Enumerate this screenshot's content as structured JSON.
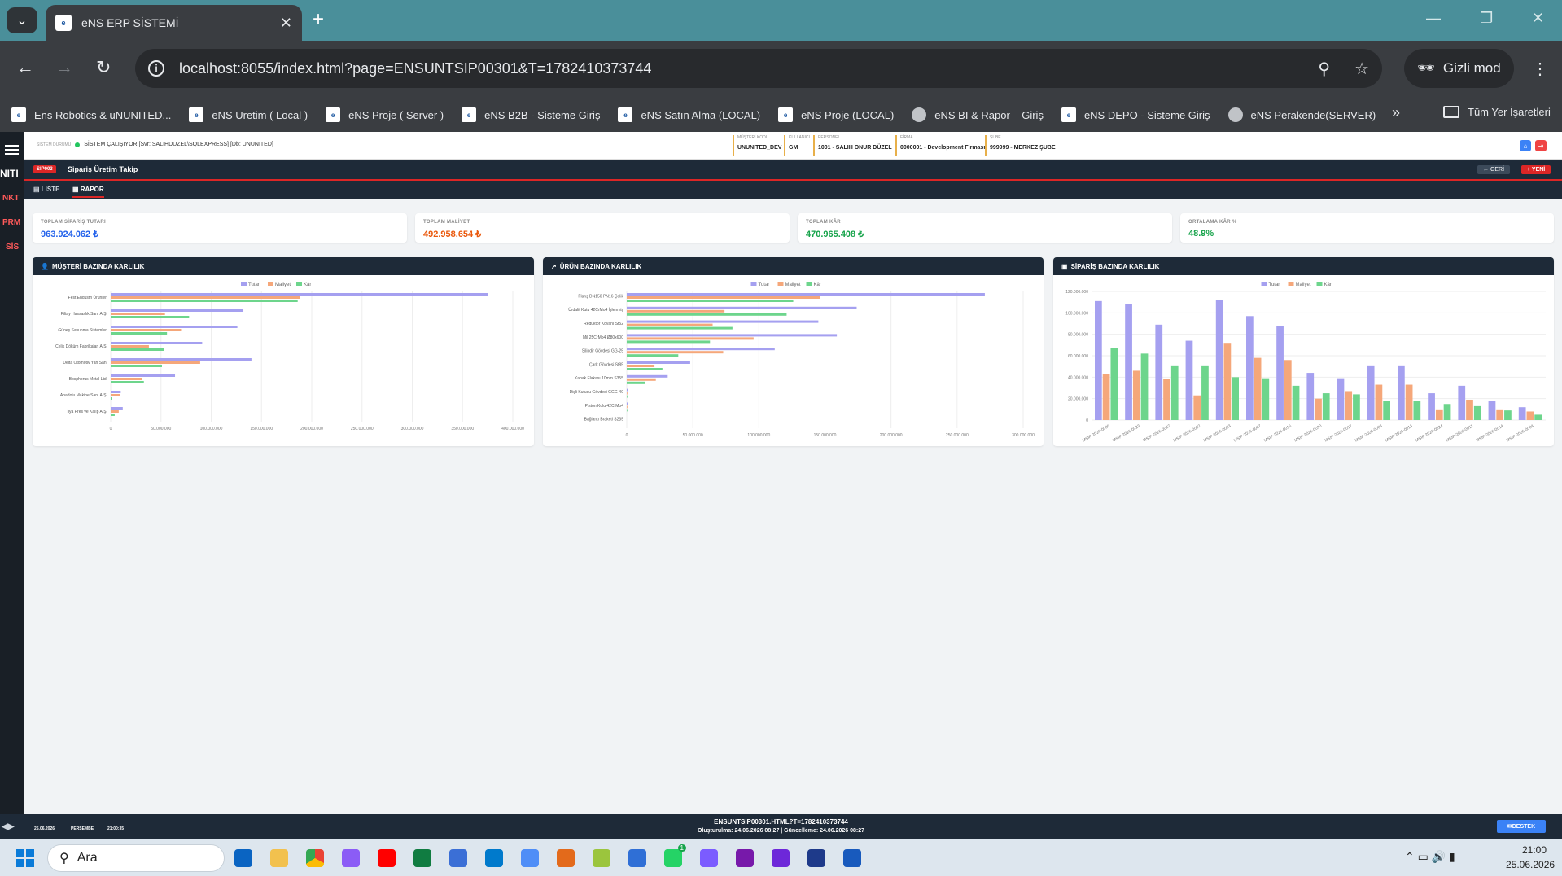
{
  "browser": {
    "tab_title": "eNS ERP SİSTEMİ",
    "url": "localhost:8055/index.html?page=ENSUNTSIP00301&T=1782410373744",
    "incognito_label": "Gizli mod",
    "all_bookmarks": "Tüm Yer İşaretleri",
    "bookmarks": [
      "Ens Robotics & uNUNITED...",
      "eNS Uretim ( Local )",
      "eNS Proje ( Server )",
      "eNS B2B - Sisteme Giriş",
      "eNS Satın Alma (LOCAL)",
      "eNS Proje (LOCAL)",
      "eNS BI & Rapor – Giriş",
      "eNS DEPO - Sisteme Giriş",
      "eNS Perakende(SERVER)"
    ]
  },
  "sidebar": {
    "brand": "NITI",
    "items": [
      "NKT",
      "PRM",
      "SİS"
    ]
  },
  "header": {
    "status_label": "SİSTEM DURUMU",
    "status_text": "SİSTEM ÇALIŞIYOR [Svr: SALIHDUZEL\\SQLEXPRESS] [Db: UNUNITED]",
    "info": [
      {
        "k": "MÜŞTERİ KODU",
        "v": "UNUNITED_DEV"
      },
      {
        "k": "KULLANICI",
        "v": "GM"
      },
      {
        "k": "PERSONEL",
        "v": "1001 - SALIH ONUR DÜZEL"
      },
      {
        "k": "FİRMA",
        "v": "0000001 - Development Firması"
      },
      {
        "k": "ŞUBE",
        "v": "999999 - MERKEZ ŞUBE"
      }
    ]
  },
  "page": {
    "badge": "SIP003",
    "title": "Sipariş Üretim Takip",
    "back_label": "← GERİ",
    "new_label": "+ YENİ",
    "tabs": [
      "LİSTE",
      "RAPOR"
    ]
  },
  "kpis": [
    {
      "label": "TOPLAM SİPARİŞ TUTARI",
      "value": "963.924.062 ₺",
      "color": "#2563eb"
    },
    {
      "label": "TOPLAM MALİYET",
      "value": "492.958.654 ₺",
      "color": "#ea580c"
    },
    {
      "label": "TOPLAM KÂR",
      "value": "470.965.408 ₺",
      "color": "#16a34a"
    },
    {
      "label": "ORTALAMA KÂR %",
      "value": "48.9%",
      "color": "#16a34a"
    }
  ],
  "panels": [
    "MÜŞTERİ BAZINDA KARLILIK",
    "ÜRÜN BAZINDA KARLILIK",
    "SİPARİŞ BAZINDA KARLILIK"
  ],
  "legend": [
    "Tutar",
    "Maliyet",
    "Kâr"
  ],
  "colors": {
    "tutar": "#a5a0f0",
    "maliyet": "#f5a77a",
    "kar": "#6dd58c"
  },
  "chart_data": [
    {
      "type": "bar",
      "orientation": "horizontal",
      "title": "MÜŞTERİ BAZINDA KARLILIK",
      "categories": [
        "Fest Endüstri Ürünleri",
        "Filtay Hassaslık San. A.Ş.",
        "Güneş Savunma Sistemleri",
        "Çelik Döküm Fabrikaları A.Ş.",
        "Delta Otomotiv Yan San.",
        "Bosphorus Metal Ltd.",
        "Anadolu Makine San. A.Ş.",
        "İlya Pres ve Kalıp A.Ş."
      ],
      "series": [
        {
          "name": "Tutar",
          "values": [
            375000000,
            132000000,
            126000000,
            91000000,
            140000000,
            64000000,
            10000000,
            12000000
          ]
        },
        {
          "name": "Maliyet",
          "values": [
            188000000,
            54000000,
            70000000,
            38000000,
            89000000,
            31000000,
            9000000,
            8000000
          ]
        },
        {
          "name": "Kâr",
          "values": [
            186000000,
            78000000,
            56000000,
            53000000,
            51000000,
            33000000,
            1000000,
            4000000
          ]
        }
      ],
      "xlim": [
        0,
        400000000
      ],
      "xticks": [
        "0",
        "50.000.000",
        "100.000.000",
        "150.000.000",
        "200.000.000",
        "250.000.000",
        "300.000.000",
        "350.000.000",
        "400.000.000"
      ]
    },
    {
      "type": "bar",
      "orientation": "horizontal",
      "title": "ÜRÜN BAZINDA KARLILIK",
      "categories": [
        "Flanş DN150 PN16 Çelik",
        "Ürdalit Kutu 42CrMo4 İşlenmiş",
        "Redüktör Kovanı St52",
        "Mil 25CrMo4 Ø80x600",
        "Silindir Gövdesi GG-25",
        "Çark Gövdesi St85",
        "Kapak Flakası 10mm S355",
        "Dişli Kutusu Gövdesi GGG-40",
        "Piston Kolu 42CrMo4",
        "Bağlantı Braketi S235"
      ],
      "series": [
        {
          "name": "Tutar",
          "values": [
            271000000,
            174000000,
            145000000,
            159000000,
            112000000,
            48000000,
            31000000,
            1000000,
            1000000,
            0
          ]
        },
        {
          "name": "Maliyet",
          "values": [
            146000000,
            74000000,
            65000000,
            96000000,
            73000000,
            21000000,
            22000000,
            500000,
            500000,
            0
          ]
        },
        {
          "name": "Kâr",
          "values": [
            126000000,
            121000000,
            80000000,
            63000000,
            39000000,
            27000000,
            14000000,
            500000,
            500000,
            0
          ]
        }
      ],
      "xlim": [
        0,
        300000000
      ],
      "xticks": [
        "0",
        "50.000.000",
        "100.000.000",
        "150.000.000",
        "200.000.000",
        "250.000.000",
        "300.000.000"
      ]
    },
    {
      "type": "bar",
      "title": "SİPARİŞ BAZINDA KARLILIK",
      "categories": [
        "MSIP-2026-0005",
        "MSIP-2026-0023",
        "MSIP-2026-0027",
        "MSIP-2026-0002",
        "MSIP-2026-0003",
        "MSIP-2026-0007",
        "MSIP-2026-0015",
        "MSIP-2026-0030",
        "MSIP-2026-0017",
        "MSIP-2026-0008",
        "MSIP-2026-0013",
        "MSIP-2026-0024",
        "MSIP-2026-0011",
        "MSIP-2026-0014",
        "MSIP-2026-0004"
      ],
      "series": [
        {
          "name": "Tutar",
          "values": [
            111000000,
            108000000,
            89000000,
            74000000,
            112000000,
            97000000,
            88000000,
            44000000,
            39000000,
            51000000,
            51000000,
            25000000,
            32000000,
            18000000,
            12000000
          ]
        },
        {
          "name": "Maliyet",
          "values": [
            43000000,
            46000000,
            38000000,
            23000000,
            72000000,
            58000000,
            56000000,
            20000000,
            27000000,
            33000000,
            33000000,
            10000000,
            19000000,
            10000000,
            8000000
          ]
        },
        {
          "name": "Kâr",
          "values": [
            67000000,
            62000000,
            51000000,
            51000000,
            40000000,
            39000000,
            32000000,
            25000000,
            24000000,
            18000000,
            18000000,
            15000000,
            13000000,
            9000000,
            5000000
          ]
        }
      ],
      "ylim": [
        0,
        120000000
      ],
      "yticks": [
        "0",
        "20.000.000",
        "40.000.000",
        "60.000.000",
        "80.000.000",
        "100.000.000",
        "120.000.000"
      ]
    }
  ],
  "footer": {
    "date": "25.06.2026",
    "day": "PERŞEMBE",
    "time": "21:00:35",
    "page_code": "ENSUNTSIP00301.HTML?T=1782410373744",
    "meta": "Oluşturulma: 24.06.2026 08:27 | Güncelleme: 24.06.2026 08:27",
    "support": "DESTEK"
  },
  "taskbar": {
    "search_placeholder": "Ara",
    "clock_time": "21:00",
    "clock_date": "25.06.2026",
    "whatsapp_badge": "1"
  }
}
